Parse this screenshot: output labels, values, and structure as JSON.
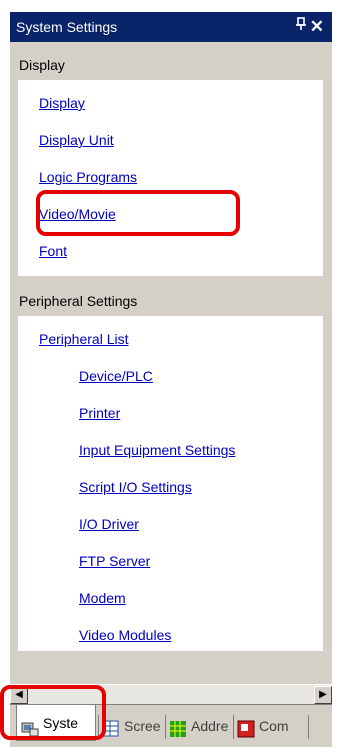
{
  "panel": {
    "title": "System Settings",
    "pin_glyph": "ᵖ",
    "close_glyph": "✕"
  },
  "groups": [
    {
      "heading": "Display",
      "items": [
        "Display",
        "Display Unit",
        "Logic Programs",
        "Video/Movie",
        "Font"
      ]
    },
    {
      "heading": "Peripheral Settings",
      "parent": "Peripheral List",
      "items": [
        "Device/PLC",
        "Printer",
        "Input Equipment Settings",
        "Script I/O Settings",
        "I/O Driver",
        "FTP Server",
        "Modem",
        "Video Modules"
      ]
    }
  ],
  "scrollbar": {
    "left_arrow": "◀",
    "right_arrow": "▶"
  },
  "tabs": [
    {
      "label": "Syste",
      "icon": "system-settings-icon",
      "active": true
    },
    {
      "label": "Scree",
      "icon": "screen-list-icon",
      "active": false
    },
    {
      "label": "Addre",
      "icon": "address-icon",
      "active": false
    },
    {
      "label": "Com",
      "icon": "common-settings-icon",
      "active": false
    }
  ],
  "colors": {
    "titlebar": "#0a246a",
    "link": "#0000c0",
    "highlight": "#e60000",
    "panel": "#d4d0c8"
  }
}
